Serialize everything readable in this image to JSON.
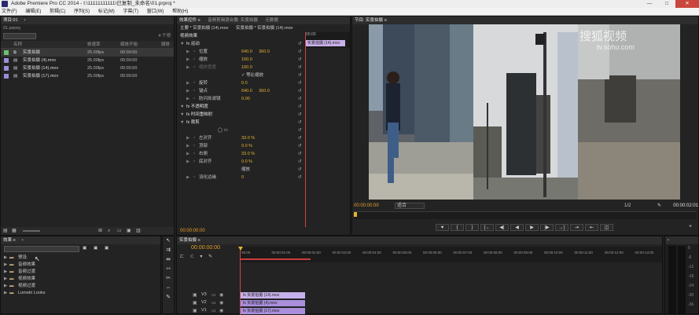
{
  "window": {
    "title": "Adobe Premiere Pro CC 2014 - I:\\11111111111\\已复制_未命名\\01.prproj *",
    "controls": [
      "—",
      "□",
      "✕"
    ]
  },
  "menu": [
    "文件(F)",
    "编辑(E)",
    "剪辑(C)",
    "序列(S)",
    "标记(M)",
    "字幕(T)",
    "窗口(W)",
    "帮助(H)"
  ],
  "project": {
    "tabs": [
      "项目:01",
      "▪"
    ],
    "file": "01.prproj",
    "count": "4 个项",
    "columns": [
      "名称",
      "帧速率",
      "媒体开始",
      "媒体"
    ],
    "items": [
      {
        "name": "实景拍摄",
        "rate": "25.00fps",
        "start": "00:00:00",
        "color": "#6bc36b",
        "type": "sequence"
      },
      {
        "name": "实景拍摄 (4).mov",
        "rate": "25.00fps",
        "start": "00:00:00",
        "color": "#9b8ed6",
        "type": "clip"
      },
      {
        "name": "实景拍摄 (14).mov",
        "rate": "25.00fps",
        "start": "00:00:00",
        "color": "#9b8ed6",
        "type": "clip"
      },
      {
        "name": "实景拍摄 (17).mov",
        "rate": "25.00fps",
        "start": "00:00:00",
        "color": "#9b8ed6",
        "type": "clip"
      }
    ]
  },
  "effectcontrols": {
    "tabs": [
      "效果控件 ≡",
      "音频剪辑混合器: 实景拍摄",
      "元数据"
    ],
    "master": "主要 * 实景拍摄 (14).mov",
    "seq": "实景拍摄 * 实景拍摄 (14).mov",
    "cliplabel": "实景拍摄 (14).mov",
    "ruler": "00:00",
    "header": "视频效果",
    "rows": [
      {
        "i": 1,
        "label": "fx  运动",
        "kind": "group"
      },
      {
        "i": 2,
        "label": "位置",
        "v1": "640.0",
        "v2": "360.0"
      },
      {
        "i": 2,
        "label": "缩放",
        "v1": "100.0"
      },
      {
        "i": 2,
        "label": "缩放宽度",
        "v1": "100.0",
        "dim": true
      },
      {
        "i": 3,
        "label": "",
        "v1": "✓ 等比缩放"
      },
      {
        "i": 2,
        "label": "旋转",
        "v1": "0.0"
      },
      {
        "i": 2,
        "label": "锚点",
        "v1": "640.0",
        "v2": "360.0"
      },
      {
        "i": 2,
        "label": "防闪烁滤镜",
        "v1": "0.00"
      },
      {
        "i": 1,
        "label": "fx  不透明度",
        "kind": "group"
      },
      {
        "i": 1,
        "label": "fx  时间重映射",
        "kind": "group"
      },
      {
        "i": 1,
        "label": "fx  裁剪",
        "kind": "group"
      },
      {
        "i": 3,
        "label": "◯  ▭",
        "v1": ""
      },
      {
        "i": 2,
        "label": "左对齐",
        "v1": "33.0 %"
      },
      {
        "i": 2,
        "label": "顶部",
        "v1": "0.0 %"
      },
      {
        "i": 2,
        "label": "右侧",
        "v1": "33.0 %"
      },
      {
        "i": 2,
        "label": "底对齐",
        "v1": "0.0 %"
      },
      {
        "i": 3,
        "label": "",
        "v1": "缩放",
        "check": true
      },
      {
        "i": 2,
        "label": "羽化边缘",
        "v1": "0"
      }
    ],
    "timecode": "00:00:00:00"
  },
  "program": {
    "tab": "节目: 实景拍摄 ≡",
    "timecode": "00:00:00:00",
    "fit": "适合",
    "quality": "1/2",
    "duration": "00:00:02:01",
    "watermark1": "搜狐视频",
    "watermark2": "tv.sohu.com",
    "buttons": [
      "♥",
      "{",
      "}",
      "{←",
      "◀|",
      "◀",
      "▶",
      "|▶",
      "→}",
      "⇥",
      "⇤",
      "◫",
      "◉"
    ]
  },
  "effects": {
    "tabs": [
      "效果 ≡",
      "▪"
    ],
    "search": "",
    "folders": [
      "预设",
      "音频效果",
      "音频过渡",
      "视频效果",
      "视频过渡",
      "Lumetri Looks"
    ]
  },
  "timeline": {
    "tabs": [
      "实景拍摄 ≡"
    ],
    "timecode": "00:00:00:00",
    "ruler": [
      "00:00",
      "00:00:01:00",
      "00:00:02:00",
      "00:00:03:00",
      "00:00:04:00",
      "00:00:05:00",
      "00:00:06:00",
      "00:00:07:00",
      "00:00:08:00",
      "00:00:09:00",
      "00:00:10:00",
      "00:00:11:00",
      "00:00:12:00",
      "00:00:13:00"
    ],
    "tracks": [
      {
        "name": "V3",
        "clip": "实景拍摄 (14).mov"
      },
      {
        "name": "V2",
        "clip": "实景拍摄 (4).mov"
      },
      {
        "name": "V1",
        "clip": "实景拍摄 (17).mov"
      }
    ]
  },
  "meter": {
    "labels": [
      "0",
      "-6",
      "-12",
      "-18",
      "-24",
      "-30",
      "-36"
    ]
  }
}
